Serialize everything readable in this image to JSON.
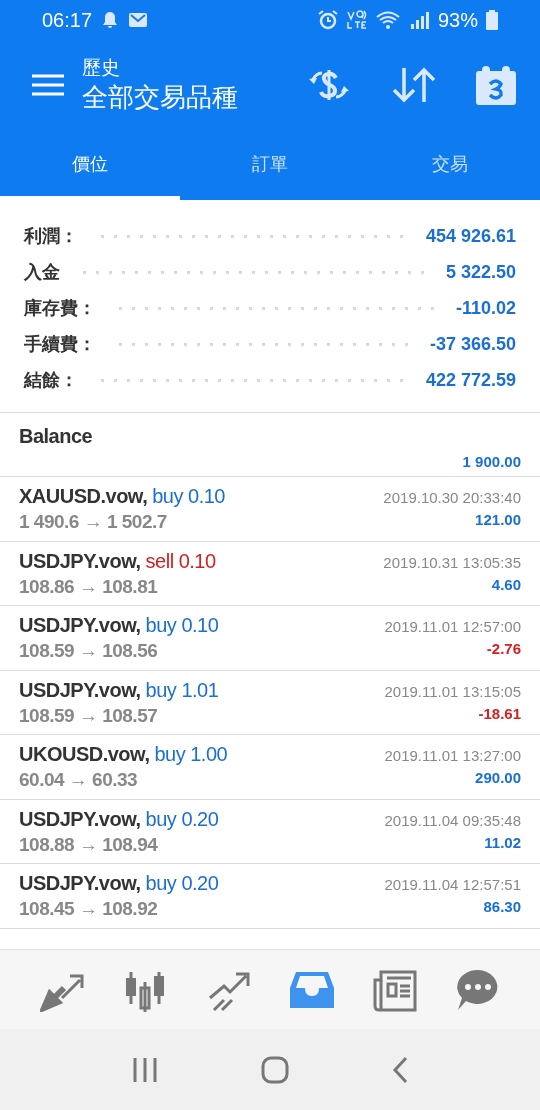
{
  "status_bar": {
    "time": "06:17",
    "battery": "93%"
  },
  "header": {
    "subtitle": "歷史",
    "title": "全部交易品種"
  },
  "tabs": [
    {
      "label": "價位",
      "selected": true
    },
    {
      "label": "訂單",
      "selected": false
    },
    {
      "label": "交易",
      "selected": false
    }
  ],
  "summary": [
    {
      "label": "利潤：",
      "value": "454 926.61"
    },
    {
      "label": "入金",
      "value": "5 322.50"
    },
    {
      "label": "庫存費：",
      "value": "-110.02"
    },
    {
      "label": "手續費：",
      "value": "-37 366.50"
    },
    {
      "label": "結餘：",
      "value": "422 772.59"
    }
  ],
  "balance": {
    "label": "Balance",
    "amount": "1 900.00"
  },
  "trades": [
    {
      "symbol": "XAUUSD.vow,",
      "side": "buy",
      "volume": "0.10",
      "prices": "1 490.6 → 1 502.7",
      "time": "2019.10.30 20:33:40",
      "profit": "121.00",
      "loss": false
    },
    {
      "symbol": "USDJPY.vow,",
      "side": "sell",
      "volume": "0.10",
      "prices": "108.86 → 108.81",
      "time": "2019.10.31 13:05:35",
      "profit": "4.60",
      "loss": false
    },
    {
      "symbol": "USDJPY.vow,",
      "side": "buy",
      "volume": "0.10",
      "prices": "108.59 → 108.56",
      "time": "2019.11.01 12:57:00",
      "profit": "-2.76",
      "loss": true
    },
    {
      "symbol": "USDJPY.vow,",
      "side": "buy",
      "volume": "1.01",
      "prices": "108.59 → 108.57",
      "time": "2019.11.01 13:15:05",
      "profit": "-18.61",
      "loss": true
    },
    {
      "symbol": "UKOUSD.vow,",
      "side": "buy",
      "volume": "1.00",
      "prices": "60.04 → 60.33",
      "time": "2019.11.01 13:27:00",
      "profit": "290.00",
      "loss": false
    },
    {
      "symbol": "USDJPY.vow,",
      "side": "buy",
      "volume": "0.20",
      "prices": "108.88 → 108.94",
      "time": "2019.11.04 09:35:48",
      "profit": "11.02",
      "loss": false
    },
    {
      "symbol": "USDJPY.vow,",
      "side": "buy",
      "volume": "0.20",
      "prices": "108.45 → 108.92",
      "time": "2019.11.04 12:57:51",
      "profit": "86.30",
      "loss": false
    }
  ],
  "bottom_nav": [
    {
      "kind": "quotes",
      "selected": false
    },
    {
      "kind": "chart",
      "selected": false
    },
    {
      "kind": "trade",
      "selected": false
    },
    {
      "kind": "history",
      "selected": true
    },
    {
      "kind": "news",
      "selected": false
    },
    {
      "kind": "chat",
      "selected": false
    }
  ]
}
